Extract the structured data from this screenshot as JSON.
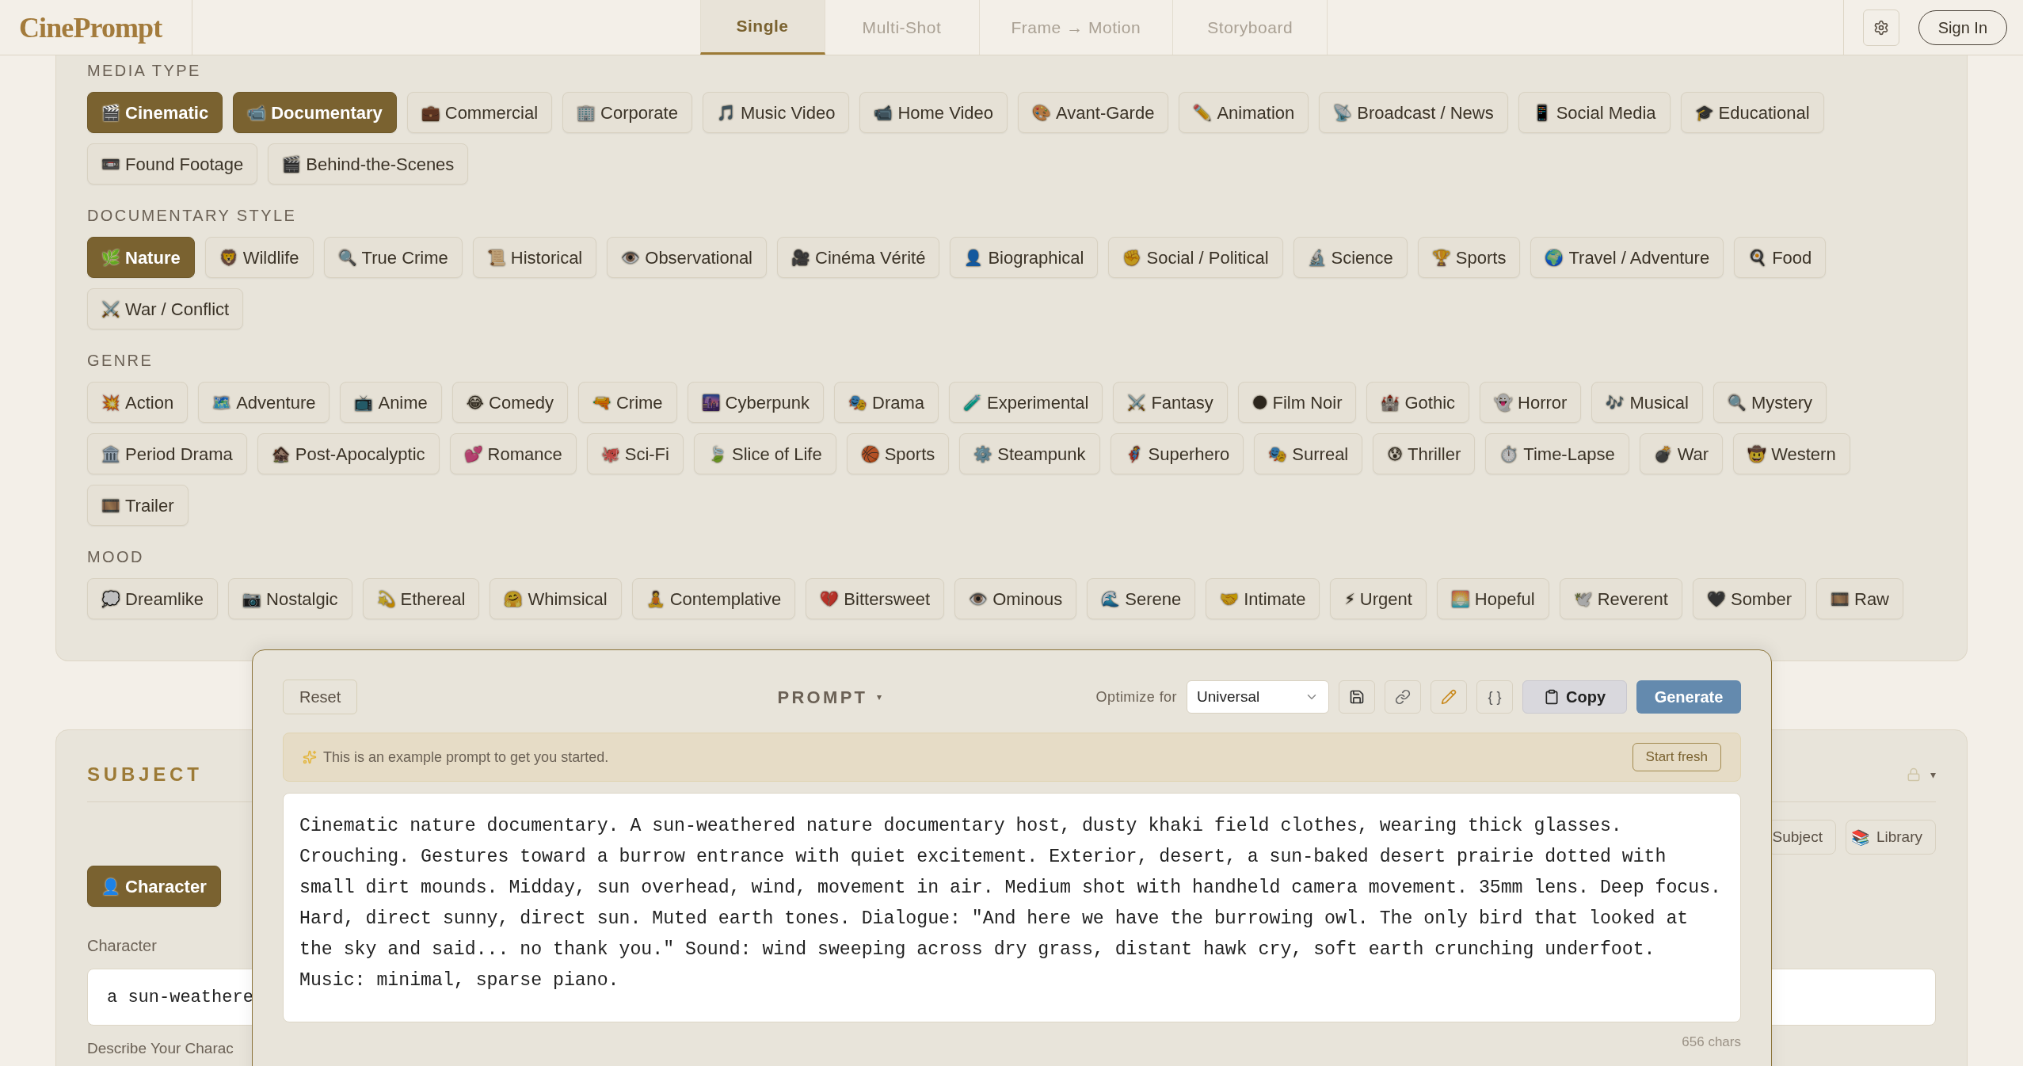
{
  "header": {
    "logo": "CinePrompt",
    "tabs": [
      {
        "label": "Single",
        "selected": true
      },
      {
        "label": "Multi-Shot",
        "selected": false
      },
      {
        "label": "Frame → Motion",
        "selected": false
      },
      {
        "label": "Storyboard",
        "selected": false
      }
    ],
    "sign_in": "Sign In"
  },
  "filters": [
    {
      "title": "MEDIA TYPE",
      "chips": [
        {
          "icon": "🎬",
          "label": "Cinematic",
          "selected": true
        },
        {
          "icon": "📹",
          "label": "Documentary",
          "selected": true
        },
        {
          "icon": "💼",
          "label": "Commercial",
          "selected": false
        },
        {
          "icon": "🏢",
          "label": "Corporate",
          "selected": false
        },
        {
          "icon": "🎵",
          "label": "Music Video",
          "selected": false
        },
        {
          "icon": "📹",
          "label": "Home Video",
          "selected": false
        },
        {
          "icon": "🎨",
          "label": "Avant-Garde",
          "selected": false
        },
        {
          "icon": "✏️",
          "label": "Animation",
          "selected": false
        },
        {
          "icon": "📡",
          "label": "Broadcast / News",
          "selected": false
        },
        {
          "icon": "📱",
          "label": "Social Media",
          "selected": false
        },
        {
          "icon": "🎓",
          "label": "Educational",
          "selected": false
        },
        {
          "icon": "📼",
          "label": "Found Footage",
          "selected": false
        },
        {
          "icon": "🎬",
          "label": "Behind-the-Scenes",
          "selected": false
        }
      ]
    },
    {
      "title": "DOCUMENTARY STYLE",
      "chips": [
        {
          "icon": "🌿",
          "label": "Nature",
          "selected": true
        },
        {
          "icon": "🦁",
          "label": "Wildlife",
          "selected": false
        },
        {
          "icon": "🔍",
          "label": "True Crime",
          "selected": false
        },
        {
          "icon": "📜",
          "label": "Historical",
          "selected": false
        },
        {
          "icon": "👁️",
          "label": "Observational",
          "selected": false
        },
        {
          "icon": "🎥",
          "label": "Cinéma Vérité",
          "selected": false
        },
        {
          "icon": "👤",
          "label": "Biographical",
          "selected": false
        },
        {
          "icon": "✊",
          "label": "Social / Political",
          "selected": false
        },
        {
          "icon": "🔬",
          "label": "Science",
          "selected": false
        },
        {
          "icon": "🏆",
          "label": "Sports",
          "selected": false
        },
        {
          "icon": "🌍",
          "label": "Travel / Adventure",
          "selected": false
        },
        {
          "icon": "🍳",
          "label": "Food",
          "selected": false
        },
        {
          "icon": "⚔️",
          "label": "War / Conflict",
          "selected": false
        }
      ]
    },
    {
      "title": "GENRE",
      "chips": [
        {
          "icon": "💥",
          "label": "Action",
          "selected": false
        },
        {
          "icon": "🗺️",
          "label": "Adventure",
          "selected": false
        },
        {
          "icon": "📺",
          "label": "Anime",
          "selected": false
        },
        {
          "icon": "😂",
          "label": "Comedy",
          "selected": false
        },
        {
          "icon": "🔫",
          "label": "Crime",
          "selected": false
        },
        {
          "icon": "🌆",
          "label": "Cyberpunk",
          "selected": false
        },
        {
          "icon": "🎭",
          "label": "Drama",
          "selected": false
        },
        {
          "icon": "🧪",
          "label": "Experimental",
          "selected": false
        },
        {
          "icon": "⚔️",
          "label": "Fantasy",
          "selected": false
        },
        {
          "icon": "🌑",
          "label": "Film Noir",
          "selected": false
        },
        {
          "icon": "🏰",
          "label": "Gothic",
          "selected": false
        },
        {
          "icon": "👻",
          "label": "Horror",
          "selected": false
        },
        {
          "icon": "🎶",
          "label": "Musical",
          "selected": false
        },
        {
          "icon": "🔍",
          "label": "Mystery",
          "selected": false
        },
        {
          "icon": "🏛️",
          "label": "Period Drama",
          "selected": false
        },
        {
          "icon": "🏚️",
          "label": "Post-Apocalyptic",
          "selected": false
        },
        {
          "icon": "💕",
          "label": "Romance",
          "selected": false
        },
        {
          "icon": "🐙",
          "label": "Sci-Fi",
          "selected": false
        },
        {
          "icon": "🍃",
          "label": "Slice of Life",
          "selected": false
        },
        {
          "icon": "🏀",
          "label": "Sports",
          "selected": false
        },
        {
          "icon": "⚙️",
          "label": "Steampunk",
          "selected": false
        },
        {
          "icon": "🦸",
          "label": "Superhero",
          "selected": false
        },
        {
          "icon": "🎭",
          "label": "Surreal",
          "selected": false
        },
        {
          "icon": "😰",
          "label": "Thriller",
          "selected": false
        },
        {
          "icon": "⏱️",
          "label": "Time-Lapse",
          "selected": false
        },
        {
          "icon": "💣",
          "label": "War",
          "selected": false
        },
        {
          "icon": "🤠",
          "label": "Western",
          "selected": false
        },
        {
          "icon": "🎞️",
          "label": "Trailer",
          "selected": false
        }
      ]
    },
    {
      "title": "MOOD",
      "chips": [
        {
          "icon": "💭",
          "label": "Dreamlike",
          "selected": false
        },
        {
          "icon": "📷",
          "label": "Nostalgic",
          "selected": false
        },
        {
          "icon": "💫",
          "label": "Ethereal",
          "selected": false
        },
        {
          "icon": "🤗",
          "label": "Whimsical",
          "selected": false
        },
        {
          "icon": "🧘",
          "label": "Contemplative",
          "selected": false
        },
        {
          "icon": "💔",
          "label": "Bittersweet",
          "selected": false
        },
        {
          "icon": "👁️",
          "label": "Ominous",
          "selected": false
        },
        {
          "icon": "🌊",
          "label": "Serene",
          "selected": false
        },
        {
          "icon": "🤝",
          "label": "Intimate",
          "selected": false
        },
        {
          "icon": "⚡",
          "label": "Urgent",
          "selected": false
        },
        {
          "icon": "🌅",
          "label": "Hopeful",
          "selected": false
        },
        {
          "icon": "🕊️",
          "label": "Reverent",
          "selected": false
        },
        {
          "icon": "🖤",
          "label": "Somber",
          "selected": false
        },
        {
          "icon": "🎞️",
          "label": "Raw",
          "selected": false
        }
      ]
    }
  ],
  "subject_panel": {
    "title": "SUBJECT",
    "caret": "▾",
    "buttons": [
      {
        "label": "Subject"
      },
      {
        "icon": "📚",
        "label": "Library"
      }
    ],
    "modes": [
      {
        "icon": "👤",
        "label": "Character",
        "selected": true
      }
    ],
    "field_label": "Character",
    "field_value": "a sun-weathere",
    "next_label": "Describe Your Charac"
  },
  "prompt": {
    "reset": "Reset",
    "title": "PROMPT",
    "title_caret": "▾",
    "optimize_label": "Optimize for",
    "optimize_value": "Universal",
    "json_button": "{ }",
    "copy": "Copy",
    "generate": "Generate",
    "notice": "This is an example prompt to get you started.",
    "start_fresh": "Start fresh",
    "text": "Cinematic nature documentary. A sun-weathered nature documentary host, dusty khaki field clothes, wearing thick glasses. Crouching. Gestures toward a burrow entrance with quiet excitement. Exterior, desert, a sun-baked desert prairie dotted with small dirt mounds. Midday, sun overhead, wind, movement in air. Medium shot with handheld camera movement. 35mm lens. Deep focus. Hard, direct sunny, direct sun. Muted earth tones. Dialogue: \"And here we have the burrowing owl. The only bird that looked at the sky and said... no thank you.\" Sound: wind sweeping across dry grass, distant hawk cry, soft earth crunching underfoot. Music: minimal, sparse piano.",
    "char_count": "656 chars"
  }
}
